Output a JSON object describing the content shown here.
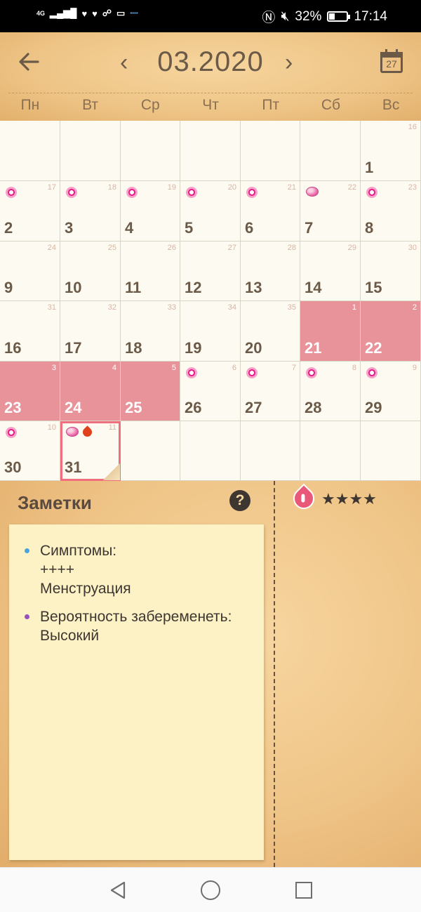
{
  "status_bar": {
    "network": "4G",
    "network_sub": "4G",
    "battery_percent": "32%",
    "battery_level": 0.32,
    "time": "17:14",
    "icons": [
      "signal-icon",
      "heart-icon",
      "heart-icon",
      "people-icon",
      "chat-icon",
      "dytmir-app-icon",
      "nfc-icon",
      "mute-icon",
      "battery-icon"
    ]
  },
  "header": {
    "title": "03.2020",
    "prev_label": "‹",
    "next_label": "›",
    "calendar_day": "27",
    "weekdays": [
      "Пн",
      "Вт",
      "Ср",
      "Чт",
      "Пт",
      "Сб",
      "Вс"
    ]
  },
  "calendar": {
    "weeks": [
      [
        null,
        null,
        null,
        null,
        null,
        null,
        {
          "day": "1",
          "cycle": "16"
        }
      ],
      [
        {
          "day": "2",
          "cycle": "17",
          "icon": "flower"
        },
        {
          "day": "3",
          "cycle": "18",
          "icon": "flower"
        },
        {
          "day": "4",
          "cycle": "19",
          "icon": "flower"
        },
        {
          "day": "5",
          "cycle": "20",
          "icon": "flower"
        },
        {
          "day": "6",
          "cycle": "21",
          "icon": "flower"
        },
        {
          "day": "7",
          "cycle": "22",
          "icon": "egg"
        },
        {
          "day": "8",
          "cycle": "23",
          "icon": "flower"
        }
      ],
      [
        {
          "day": "9",
          "cycle": "24"
        },
        {
          "day": "10",
          "cycle": "25"
        },
        {
          "day": "11",
          "cycle": "26"
        },
        {
          "day": "12",
          "cycle": "27"
        },
        {
          "day": "13",
          "cycle": "28"
        },
        {
          "day": "14",
          "cycle": "29"
        },
        {
          "day": "15",
          "cycle": "30"
        }
      ],
      [
        {
          "day": "16",
          "cycle": "31"
        },
        {
          "day": "17",
          "cycle": "32"
        },
        {
          "day": "18",
          "cycle": "33"
        },
        {
          "day": "19",
          "cycle": "34"
        },
        {
          "day": "20",
          "cycle": "35"
        },
        {
          "day": "21",
          "cycle": "1",
          "period": true
        },
        {
          "day": "22",
          "cycle": "2",
          "period": true
        }
      ],
      [
        {
          "day": "23",
          "cycle": "3",
          "period": true
        },
        {
          "day": "24",
          "cycle": "4",
          "period": true
        },
        {
          "day": "25",
          "cycle": "5",
          "period": true
        },
        {
          "day": "26",
          "cycle": "6",
          "icon": "flower"
        },
        {
          "day": "27",
          "cycle": "7",
          "icon": "flower"
        },
        {
          "day": "28",
          "cycle": "8",
          "icon": "flower"
        },
        {
          "day": "29",
          "cycle": "9",
          "icon": "flower"
        }
      ],
      [
        {
          "day": "30",
          "cycle": "10",
          "icon": "flower"
        },
        {
          "day": "31",
          "cycle": "11",
          "icon": "egg",
          "drop": true,
          "today": true
        },
        null,
        null,
        null,
        null,
        null
      ]
    ],
    "colors": {
      "period": "#e8929a",
      "today_border": "#f06e7e",
      "fertile_flower": "#e81e8c"
    }
  },
  "notes": {
    "title": "Заметки",
    "help_label": "?",
    "flow_stars": "★★★★",
    "flow_level": 4,
    "items": [
      {
        "text": "Симптомы:\n++++\nМенструация",
        "color": "#4aa3df"
      },
      {
        "text": "Вероятность забеременеть:\nВысокий",
        "color": "#9b4fbf"
      }
    ]
  },
  "nav_bar": {
    "icons": [
      "back-triangle-icon",
      "home-circle-icon",
      "recents-square-icon"
    ]
  }
}
